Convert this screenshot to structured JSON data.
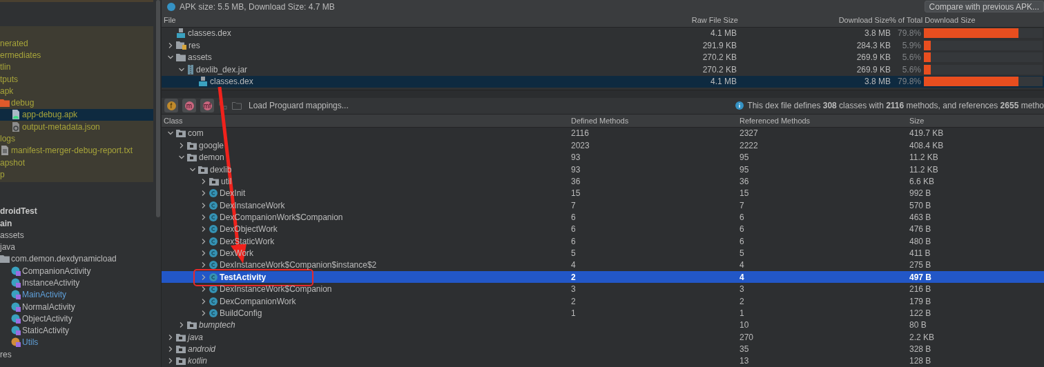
{
  "project_tree": {
    "build_items": [
      {
        "label": "nerated",
        "selected": false,
        "modified": false
      },
      {
        "label": "ermediates",
        "selected": false,
        "modified": false
      },
      {
        "label": "tlin",
        "selected": false,
        "modified": false
      },
      {
        "label": "tputs",
        "selected": false,
        "modified": false
      },
      {
        "label": "apk",
        "selected": false,
        "modified": false,
        "children": [
          {
            "label": "debug",
            "kind": "output-folder",
            "selected": false,
            "modified": false,
            "children": [
              {
                "label": "app-debug.apk",
                "kind": "apk",
                "selected": true,
                "modified": false
              },
              {
                "label": "output-metadata.json",
                "kind": "json",
                "selected": false,
                "modified": false
              }
            ]
          }
        ]
      },
      {
        "label": "logs",
        "selected": false,
        "modified": false,
        "children": [
          {
            "label": "manifest-merger-debug-report.txt",
            "kind": "txt",
            "selected": false,
            "modified": false
          }
        ]
      },
      {
        "label": "apshot",
        "selected": false,
        "modified": false
      },
      {
        "label": "p",
        "selected": false,
        "modified": false
      }
    ],
    "source_items": [
      {
        "label": "droidTest",
        "kind": "root",
        "selected": false,
        "modified": false
      },
      {
        "label": "ain",
        "kind": "root",
        "selected": false,
        "modified": false
      },
      {
        "label": "assets",
        "selected": false,
        "modified": false
      },
      {
        "label": "java",
        "selected": false,
        "modified": false,
        "children": [
          {
            "label": "com.demon.dexdynamicload",
            "kind": "folder",
            "selected": false,
            "modified": false,
            "children": [
              {
                "label": "CompanionActivity",
                "kind": "class",
                "selected": false,
                "modified": false
              },
              {
                "label": "InstanceActivity",
                "kind": "class",
                "selected": false,
                "modified": false
              },
              {
                "label": "MainActivity",
                "kind": "class",
                "selected": false,
                "modified": true
              },
              {
                "label": "NormalActivity",
                "kind": "class",
                "selected": false,
                "modified": false
              },
              {
                "label": "ObjectActivity",
                "kind": "class",
                "selected": false,
                "modified": false
              },
              {
                "label": "StaticActivity",
                "kind": "class",
                "selected": false,
                "modified": false
              },
              {
                "label": "Utils",
                "kind": "object",
                "selected": false,
                "modified": true
              }
            ]
          }
        ]
      },
      {
        "label": "res",
        "selected": false,
        "modified": false
      }
    ]
  },
  "apk_summary": "APK size: 5.5 MB, Download Size: 4.7 MB",
  "compare_button": "Compare with previous APK...",
  "file_table": {
    "columns": [
      "File",
      "Raw File Size",
      "Download Size",
      "% of Total Download Size"
    ],
    "rows": [
      {
        "name": "classes.dex",
        "kind": "dex",
        "selected": false,
        "raw": "4.1 MB",
        "download": "3.8 MB",
        "percent": "79.8%",
        "level": 0.798
      },
      {
        "name": "res",
        "kind": "res-folder",
        "expanded": false,
        "selected": false,
        "raw": "291.9 KB",
        "download": "284.3 KB",
        "percent": "5.9%",
        "level": 0.059
      },
      {
        "name": "assets",
        "kind": "folder",
        "expanded": true,
        "selected": false,
        "raw": "270.2 KB",
        "download": "269.9 KB",
        "percent": "5.6%",
        "level": 0.056,
        "children": [
          {
            "name": "dexlib_dex.jar",
            "kind": "jar",
            "expanded": true,
            "selected": false,
            "raw": "270.2 KB",
            "download": "269.9 KB",
            "percent": "5.6%",
            "level": 0.056,
            "children": [
              {
                "name": "classes.dex",
                "kind": "dex",
                "selected": true,
                "raw": "4.1 MB",
                "download": "3.8 MB",
                "percent": "79.8%",
                "level": 0.798
              }
            ]
          }
        ]
      }
    ]
  },
  "toolbar": {
    "filter_buttons": [
      "f",
      "m",
      "mf"
    ],
    "load_mappings": "Load Proguard mappings...",
    "info": "This dex file defines **308** classes with **2116** methods, and references **2655** metho"
  },
  "class_table": {
    "columns": [
      "Class",
      "Defined Methods",
      "Referenced Methods",
      "Size"
    ],
    "rows": [
      {
        "name": "com",
        "kind": "package",
        "expanded": true,
        "selected": false,
        "defined": "2116",
        "referenced": "2327",
        "size": "419.7 KB",
        "children": [
          {
            "name": "google",
            "kind": "package",
            "expanded": false,
            "selected": false,
            "defined": "2023",
            "referenced": "2222",
            "size": "408.4 KB"
          },
          {
            "name": "demon",
            "kind": "package",
            "expanded": true,
            "selected": false,
            "defined": "93",
            "referenced": "95",
            "size": "11.2 KB",
            "children": [
              {
                "name": "dexlib",
                "kind": "package",
                "expanded": true,
                "selected": false,
                "defined": "93",
                "referenced": "95",
                "size": "11.2 KB",
                "children": [
                  {
                    "name": "util",
                    "kind": "package",
                    "expanded": false,
                    "selected": false,
                    "defined": "36",
                    "referenced": "36",
                    "size": "6.6 KB"
                  },
                  {
                    "name": "DexInit",
                    "kind": "class",
                    "expanded": false,
                    "selected": false,
                    "defined": "15",
                    "referenced": "15",
                    "size": "992 B"
                  },
                  {
                    "name": "DexInstanceWork",
                    "kind": "class",
                    "expanded": false,
                    "selected": false,
                    "defined": "7",
                    "referenced": "7",
                    "size": "570 B"
                  },
                  {
                    "name": "DexCompanionWork$Companion",
                    "kind": "class",
                    "expanded": false,
                    "selected": false,
                    "defined": "6",
                    "referenced": "6",
                    "size": "463 B"
                  },
                  {
                    "name": "DexObjectWork",
                    "kind": "class",
                    "expanded": false,
                    "selected": false,
                    "defined": "6",
                    "referenced": "6",
                    "size": "476 B"
                  },
                  {
                    "name": "DexStaticWork",
                    "kind": "class",
                    "expanded": false,
                    "selected": false,
                    "defined": "6",
                    "referenced": "6",
                    "size": "480 B"
                  },
                  {
                    "name": "DexWork",
                    "kind": "class",
                    "expanded": false,
                    "selected": false,
                    "defined": "5",
                    "referenced": "5",
                    "size": "411 B"
                  },
                  {
                    "name": "DexInstanceWork$Companion$instance$2",
                    "kind": "class",
                    "expanded": false,
                    "selected": false,
                    "defined": "4",
                    "referenced": "4",
                    "size": "275 B"
                  },
                  {
                    "name": "TestActivity",
                    "kind": "class",
                    "expanded": false,
                    "selected": true,
                    "defined": "2",
                    "referenced": "4",
                    "size": "497 B"
                  },
                  {
                    "name": "DexInstanceWork$Companion",
                    "kind": "class",
                    "expanded": false,
                    "selected": false,
                    "defined": "3",
                    "referenced": "3",
                    "size": "216 B"
                  },
                  {
                    "name": "DexCompanionWork",
                    "kind": "class",
                    "expanded": false,
                    "selected": false,
                    "defined": "2",
                    "referenced": "2",
                    "size": "179 B"
                  },
                  {
                    "name": "BuildConfig",
                    "kind": "class",
                    "expanded": false,
                    "selected": false,
                    "defined": "1",
                    "referenced": "1",
                    "size": "122 B"
                  }
                ]
              }
            ]
          },
          {
            "name": "bumptech",
            "kind": "referenced-package",
            "expanded": false,
            "selected": false,
            "referenced": "10",
            "size": "80 B"
          }
        ]
      },
      {
        "name": "java",
        "kind": "referenced-package",
        "expanded": false,
        "selected": false,
        "referenced": "270",
        "size": "2.2 KB"
      },
      {
        "name": "android",
        "kind": "referenced-package",
        "expanded": false,
        "selected": false,
        "referenced": "35",
        "size": "328 B"
      },
      {
        "name": "kotlin",
        "kind": "referenced-package",
        "expanded": false,
        "selected": false,
        "referenced": "13",
        "size": "128 B"
      }
    ]
  }
}
